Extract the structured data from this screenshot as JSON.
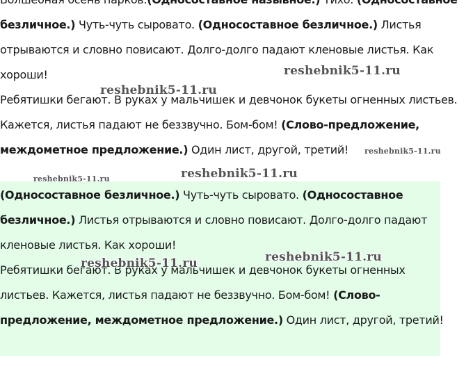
{
  "section1": {
    "lines": [
      [
        {
          "t": "Волшебная осень парков.",
          "b": false
        },
        {
          "t": "(Односоставное назывное.)",
          "b": true
        },
        {
          "t": " Тихо. ",
          "b": false
        },
        {
          "t": "(Односоставное",
          "b": true
        }
      ],
      [
        {
          "t": "безличное.)",
          "b": true
        },
        {
          "t": " Чуть-чуть сыровато. ",
          "b": false
        },
        {
          "t": "(Односоставное безличное.)",
          "b": true
        },
        {
          "t": " Листья",
          "b": false
        }
      ],
      [
        {
          "t": "отрываются и словно повисают. Долго-долго падают кленовые листья. Как",
          "b": false
        }
      ],
      [
        {
          "t": "хороши!",
          "b": false
        }
      ],
      [
        {
          "t": "Ребятишки бегают. В руках у мальчишек и девчонок букеты огненных листьев.",
          "b": false
        }
      ],
      [
        {
          "t": "Кажется, листья падают не беззвучно. Бом-бом! ",
          "b": false
        },
        {
          "t": "(Слово-предложение,",
          "b": true
        }
      ],
      [
        {
          "t": "междометное предложение.)",
          "b": true
        },
        {
          "t": " Один лист, другой, третий!",
          "b": false
        }
      ]
    ]
  },
  "section2": {
    "lines": [
      [
        {
          "t": "(Односоставное безличное.)",
          "b": true
        },
        {
          "t": " Чуть-чуть сыровато. ",
          "b": false
        },
        {
          "t": "(Односоставное",
          "b": true
        }
      ],
      [
        {
          "t": "безличное.)",
          "b": true
        },
        {
          "t": " Листья отрываются и словно повисают. Долго-долго падают",
          "b": false
        }
      ],
      [
        {
          "t": "кленовые листья. Как хороши!",
          "b": false
        }
      ],
      [
        {
          "t": "Ребятишки бегают. В руках у мальчишек и девчонок букеты огненных",
          "b": false
        }
      ],
      [
        {
          "t": "листьев. Кажется, листья падают не беззвучно. Бом-бом! ",
          "b": false
        },
        {
          "t": "(Слово-",
          "b": true
        }
      ],
      [
        {
          "t": "предложение, междометное предложение.)",
          "b": true
        },
        {
          "t": " Один лист, другой, третий!",
          "b": false
        }
      ]
    ]
  },
  "watermarks": [
    "reshebnik5-11.ru",
    "reshebnik5-11.ru",
    "reshebnik5-11.ru",
    "reshebnik5-11.ru",
    "reshebnik5-11.ru",
    "reshebnik5-11.ru",
    "reshebnik5-11.ru"
  ],
  "colors": {
    "text": "#1a1a1a",
    "answer_background": "#e3fde9",
    "watermark": "#555555"
  }
}
